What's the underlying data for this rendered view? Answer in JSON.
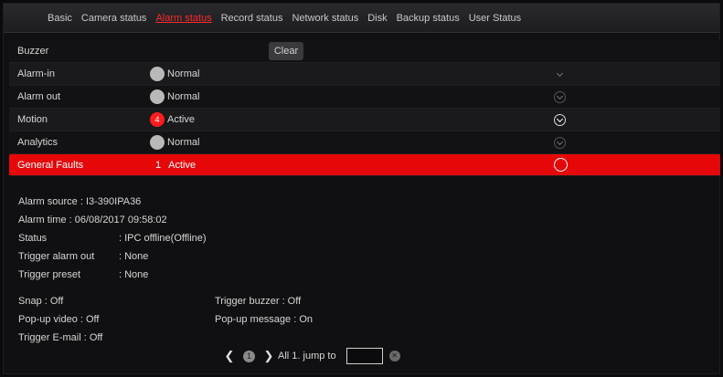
{
  "tabs": [
    {
      "label": "Basic",
      "active": false
    },
    {
      "label": "Camera status",
      "active": false
    },
    {
      "label": "Alarm status",
      "active": true
    },
    {
      "label": "Record status",
      "active": false
    },
    {
      "label": "Network status",
      "active": false
    },
    {
      "label": "Disk",
      "active": false
    },
    {
      "label": "Backup status",
      "active": false
    },
    {
      "label": "User Status",
      "active": false
    }
  ],
  "alarms": {
    "header": {
      "label": "Buzzer",
      "clear_label": "Clear"
    },
    "rows": [
      {
        "name": "Alarm-in",
        "count": "",
        "status": "Normal",
        "expand_icon": "chevron-down-icon"
      },
      {
        "name": "Alarm out",
        "count": "",
        "status": "Normal",
        "expand_icon": "chevron-down-icon"
      },
      {
        "name": "Motion",
        "count": "4",
        "status": "Active",
        "expand_icon": "chevron-down-icon"
      },
      {
        "name": "Analytics",
        "count": "",
        "status": "Normal",
        "expand_icon": "chevron-down-icon"
      },
      {
        "name": "General Faults",
        "count": "1",
        "status": "Active",
        "expand_icon": "circle-icon"
      }
    ]
  },
  "details": {
    "alarm_source": "Alarm source  : I3-390IPA36",
    "alarm_time": "Alarm time  : 06/08/2017 09:58:02",
    "status_label": "Status",
    "status_value": ": IPC offline(Offline)",
    "trigger_alarm_out_label": "Trigger alarm out",
    "trigger_alarm_out_value": ": None",
    "trigger_preset_label": "Trigger preset",
    "trigger_preset_value": ": None"
  },
  "options": {
    "snap": "Snap : Off",
    "trigger_buzzer": "Trigger buzzer : Off",
    "popup_video": "Pop-up video : Off",
    "popup_message": "Pop-up message : On",
    "trigger_email": "Trigger E-mail : Off"
  },
  "pager": {
    "prev": "❮",
    "page": "1",
    "next": "❯",
    "summary": "All 1. jump to",
    "jump_value": "",
    "go_icon": "go-icon"
  },
  "colors": {
    "accent": "#ff2b2b",
    "fault_row": "#e60808"
  }
}
